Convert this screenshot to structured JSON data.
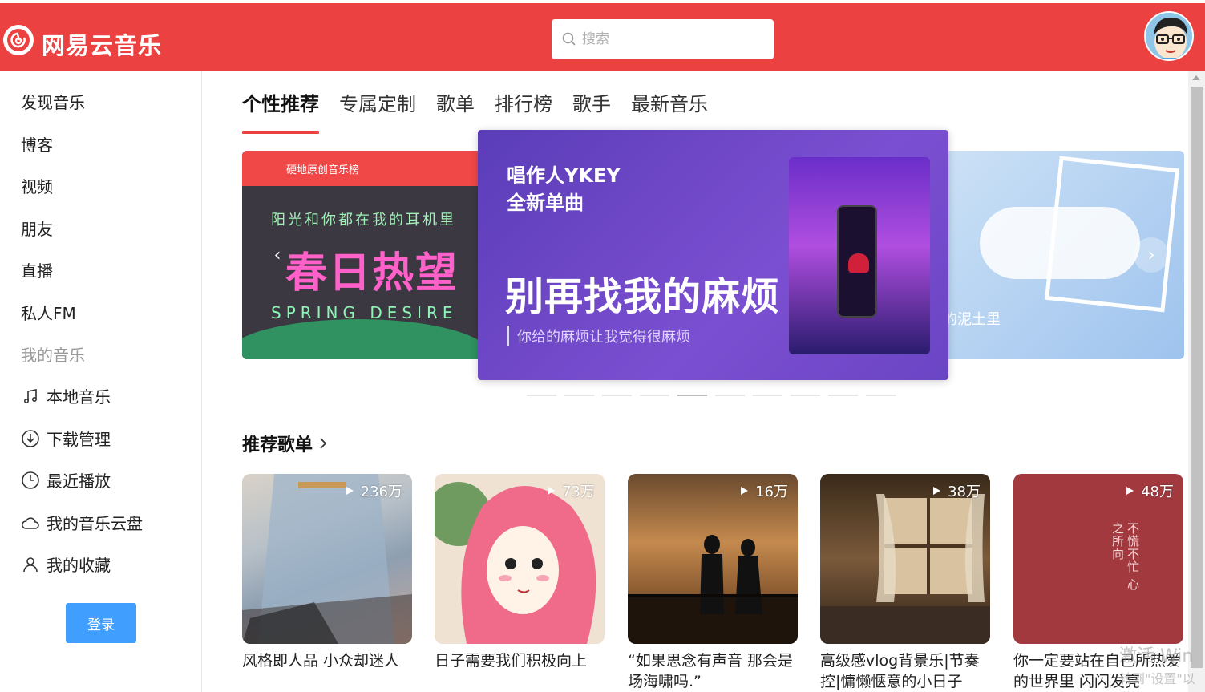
{
  "header": {
    "brand": "网易云音乐",
    "search_placeholder": "搜索"
  },
  "sidebar": {
    "items": [
      {
        "label": "发现音乐"
      },
      {
        "label": "博客"
      },
      {
        "label": "视频"
      },
      {
        "label": "朋友"
      },
      {
        "label": "直播"
      },
      {
        "label": "私人FM"
      }
    ],
    "my_music_heading": "我的音乐",
    "my_items": [
      {
        "label": "本地音乐",
        "icon": "music-note-icon"
      },
      {
        "label": "下载管理",
        "icon": "download-icon"
      },
      {
        "label": "最近播放",
        "icon": "clock-icon"
      },
      {
        "label": "我的音乐云盘",
        "icon": "cloud-icon"
      },
      {
        "label": "我的收藏",
        "icon": "user-icon"
      }
    ],
    "login_label": "登录"
  },
  "tabs": [
    {
      "label": "个性推荐",
      "active": true
    },
    {
      "label": "专属定制"
    },
    {
      "label": "歌单"
    },
    {
      "label": "排行榜"
    },
    {
      "label": "歌手"
    },
    {
      "label": "最新音乐"
    }
  ],
  "banner": {
    "left": {
      "chart_name": "硬地原创音乐榜",
      "line1": "阳光和你都在我的耳机里",
      "big": "春日热望",
      "en": "SPRING DESIRE"
    },
    "center": {
      "sub_line1": "唱作人YKEY",
      "sub_line2": "全新单曲",
      "title": "别再找我的麻烦",
      "desc": "你给的麻烦让我觉得很麻烦"
    },
    "right": {
      "text": "的泥土里"
    },
    "dots_count": 10,
    "active_dot": 4
  },
  "section": {
    "title": "推荐歌单"
  },
  "playlists": [
    {
      "count": "236万",
      "name": "风格即人品 小众却迷人"
    },
    {
      "count": "73万",
      "name": "日子需要我们积极向上"
    },
    {
      "count": "16万",
      "name": "“如果思念有声音 那会是场海啸吗.”"
    },
    {
      "count": "38万",
      "name": "高级感vlog背景乐|节奏控|慵懒惬意的小日子"
    },
    {
      "count": "48万",
      "name": "你一定要站在自己所热爱的世界里 闪闪发亮"
    }
  ],
  "card5_art": "不慌不忙 心之所向",
  "watermark": {
    "line1": "激活 Win",
    "line2": "转到\"设置\"以激"
  },
  "colors": {
    "brand_red": "#ec4141",
    "login_blue": "#409eff"
  }
}
